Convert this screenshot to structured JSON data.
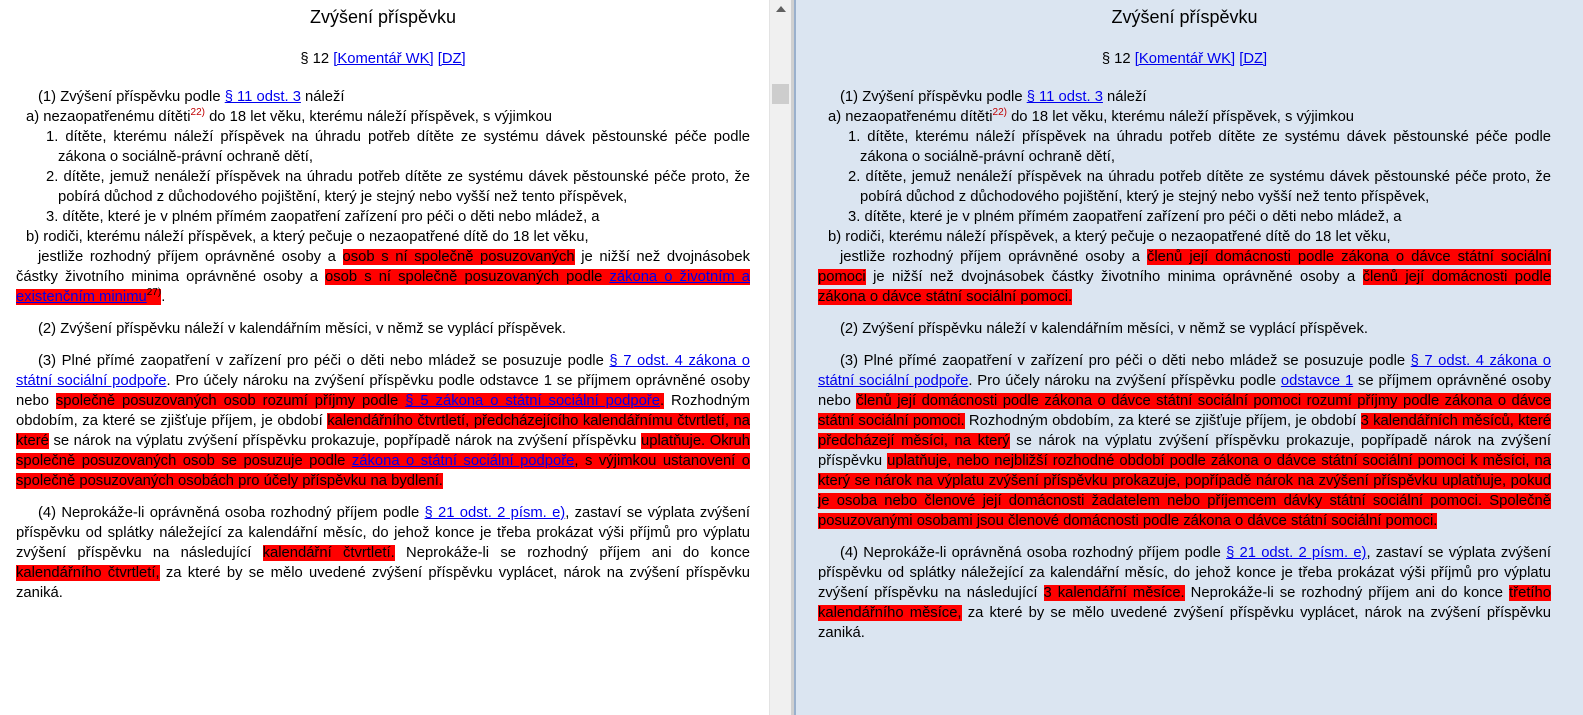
{
  "left": {
    "title": "Zvýšení příspěvku",
    "par": "§ 12",
    "komentar": "[Komentář WK]",
    "dz": "[DZ]",
    "s1_a": "(1) Zvýšení příspěvku podle ",
    "s1_link": "§ 11 odst. 3",
    "s1_b": " náleží",
    "a_a": "a) nezaopatřenému dítěti",
    "a_sup": "22)",
    "a_b": " do 18 let věku, kterému náleží příspěvek, s výjimkou",
    "i1": "1. dítěte, kterému náleží příspěvek na úhradu potřeb dítěte ze systému dávek pěstounské péče podle zákona o sociálně-právní ochraně dětí,",
    "i2": "2. dítěte, jemuž nenáleží příspěvek na úhradu potřeb dítěte ze systému dávek pěstounské péče proto, že pobírá důchod z důchodového pojištění, který je stejný nebo vyšší než tento příspěvek,",
    "i3": "3. dítěte, které je v plném přímém zaopatření zařízení pro péči o děti nebo mládež, a",
    "b": "b) rodiči, kterému náleží příspěvek, a který pečuje o nezaopatřené dítě do 18 let věku,",
    "j_a": "jestliže rozhodný příjem oprávněné osoby a ",
    "j_h1": "osob s ní společně posuzovaných",
    "j_b": " je nižší než dvojnásobek částky životního minima oprávněné osoby a ",
    "j_h2": "osob s ní společně posuzovaných podle",
    "j_h2_sp": " ",
    "j_link": "zákona o životním a existenčním minimu",
    "j_sup": "27)",
    "j_end": ".",
    "s2": "(2) Zvýšení příspěvku náleží v kalendářním měsíci, v němž se vyplácí příspěvek.",
    "s3_a": "(3) Plné přímé zaopatření v zařízení pro péči o děti nebo mládež se posuzuje podle ",
    "s3_link1": "§ 7 odst. 4 zákona o státní sociální podpoře",
    "s3_b": ". Pro účely nároku na zvýšení příspěvku podle odstavce 1 se příjmem oprávněné osoby nebo ",
    "s3_h1": "společně posuzovaných osob rozumí příjmy podle ",
    "s3_h1_link": "§ 5 zákona o státní sociální podpoře",
    "s3_h1_end": ".",
    "s3_c": " Rozhodným obdobím, za které se zjišťuje příjem, je období ",
    "s3_h2": "kalendářního čtvrtletí, předcházejícího kalendářnímu čtvrtletí, na které",
    "s3_d": " se nárok na výplatu zvýšení příspěvku prokazuje, popřípadě nárok na zvýšení příspěvku ",
    "s3_h3": "uplatňuje. Okruh společně posuzovaných osob se posuzuje podle ",
    "s3_h3_link": "zákona o státní sociální podpoře",
    "s3_h3_mid": ", s výjimkou ustanovení o společně posuzovaných osobách pro účely příspěvku na bydlení.",
    "s4_a": "(4) Neprokáže-li oprávněná osoba rozhodný příjem podle ",
    "s4_link": "§ 21 odst. 2 písm. e)",
    "s4_b": ", zastaví se výplata zvýšení příspěvku od splátky náležející za kalendářní měsíc, do jehož konce je třeba prokázat výši příjmů pro výplatu zvýšení příspěvku na následující ",
    "s4_h1": "kalendářní čtvrtletí.",
    "s4_c": " Neprokáže-li se rozhodný příjem ani do konce ",
    "s4_h2": "kalendářního čtvrtletí,",
    "s4_d": " za které by se mělo uvedené zvýšení příspěvku vyplácet, nárok na zvýšení příspěvku zaniká."
  },
  "right": {
    "title": "Zvýšení příspěvku",
    "par": "§ 12",
    "komentar": "[Komentář WK]",
    "dz": "[DZ]",
    "s1_a": "(1) Zvýšení příspěvku podle ",
    "s1_link": "§ 11 odst. 3",
    "s1_b": " náleží",
    "a_a": "a) nezaopatřenému dítěti",
    "a_sup": "22)",
    "a_b": " do 18 let věku, kterému náleží příspěvek, s výjimkou",
    "i1": "1. dítěte, kterému náleží příspěvek na úhradu potřeb dítěte ze systému dávek pěstounské péče podle zákona o sociálně-právní ochraně dětí,",
    "i2": "2. dítěte, jemuž nenáleží příspěvek na úhradu potřeb dítěte ze systému dávek pěstounské péče proto, že pobírá důchod z důchodového pojištění, který je stejný nebo vyšší než tento příspěvek,",
    "i3": "3. dítěte, které je v plném přímém zaopatření zařízení pro péči o děti nebo mládež, a",
    "b": "b) rodiči, kterému náleží příspěvek, a který pečuje o nezaopatřené dítě do 18 let věku,",
    "j_a": "jestliže rozhodný příjem oprávněné osoby a ",
    "j_h1": "členů její domácnosti podle zákona o dávce státní sociální pomoci",
    "j_b": " je nižší než dvojnásobek částky životního minima oprávněné osoby a ",
    "j_h2": "členů její domácnosti podle zákona o dávce státní sociální pomoci.",
    "s2": "(2) Zvýšení příspěvku náleží v kalendářním měsíci, v němž se vyplácí příspěvek.",
    "s3_a": "(3) Plné přímé zaopatření v zařízení pro péči o děti nebo mládež se posuzuje podle ",
    "s3_link1": "§ 7 odst. 4 zákona o státní sociální podpoře",
    "s3_b": ". Pro účely nároku na zvýšení příspěvku podle ",
    "s3_link2": "odstavce 1",
    "s3_b2": " se příjmem oprávněné osoby nebo ",
    "s3_h1": "členů její domácnosti podle zákona o dávce státní sociální pomoci rozumí příjmy podle zákona o dávce státní sociální pomoci.",
    "s3_c": " Rozhodným obdobím, za které se zjišťuje příjem, je období ",
    "s3_h2": "3 kalendářních měsíců, které předcházejí měsíci, na který",
    "s3_d": " se nárok na výplatu zvýšení příspěvku prokazuje, popřípadě nárok na zvýšení příspěvku ",
    "s3_h3": "uplatňuje, nebo nejbližší rozhodné období podle zákona o dávce státní sociální pomoci k měsíci, na který se nárok na výplatu zvýšení příspěvku prokazuje, popřípadě nárok na zvýšení příspěvku uplatňuje, pokud je osoba nebo členové její domácnosti žadatelem nebo příjemcem dávky státní sociální pomoci. Společně posuzovanými osobami jsou členové domácnosti podle zákona o dávce státní sociální pomoci.",
    "s4_a": "(4) Neprokáže-li oprávněná osoba rozhodný příjem podle ",
    "s4_link": "§ 21 odst. 2 písm. e)",
    "s4_b": ", zastaví se výplata zvýšení příspěvku od splátky náležející za kalendářní měsíc, do jehož konce je třeba prokázat výši příjmů pro výplatu zvýšení příspěvku na následující ",
    "s4_h1": "3 kalendářní měsíce.",
    "s4_c": " Neprokáže-li se rozhodný příjem ani do konce ",
    "s4_h2": "třetího kalendářního měsíce,",
    "s4_d": " za které by se mělo uvedené zvýšení příspěvku vyplácet, nárok na zvýšení příspěvku zaniká."
  },
  "colors": {
    "highlight": "#ff0000",
    "link": "#0000ee",
    "right_background": "#dbe5f1"
  }
}
